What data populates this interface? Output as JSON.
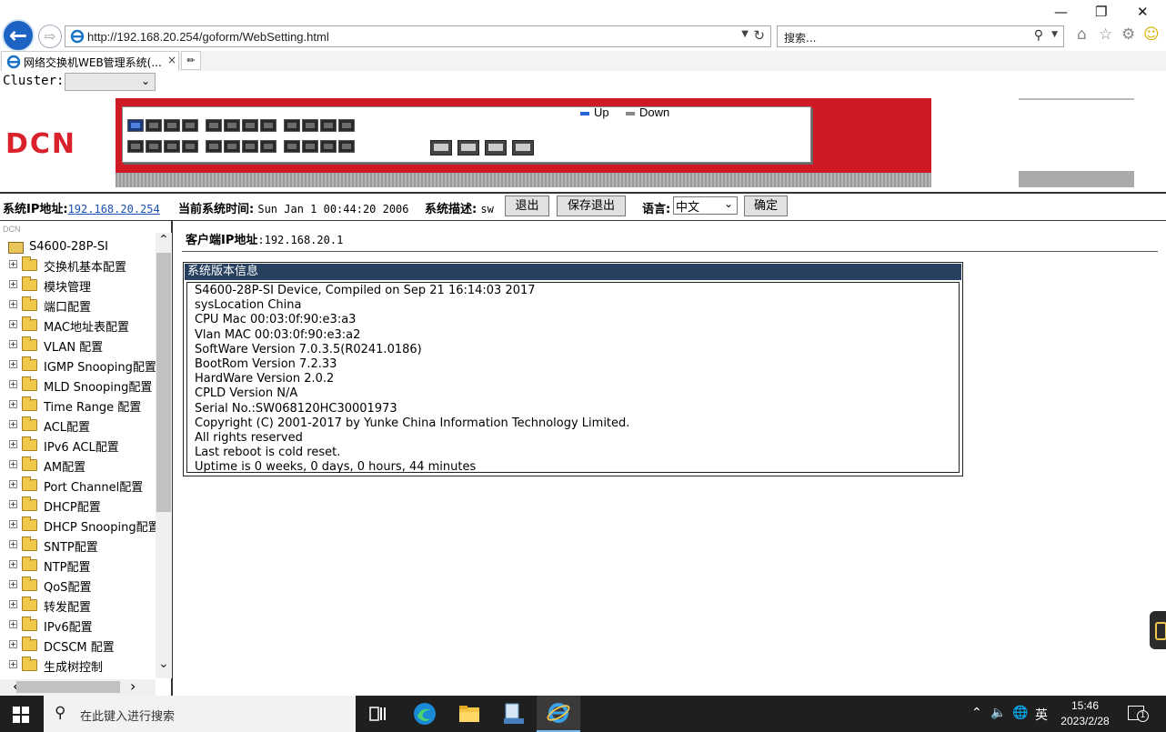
{
  "browser": {
    "url": "http://192.168.20.254/goform/WebSetting.html",
    "search_placeholder": "搜索...",
    "tab_title": "网络交换机WEB管理系统(...",
    "tab_close": "×"
  },
  "cluster": {
    "label": "Cluster:",
    "selected": ""
  },
  "header": {
    "logo_text": "DCN",
    "legend_up": "Up",
    "legend_down": "Down",
    "colors": {
      "banner": "#cf1a26",
      "port_up": "#4d7fdc",
      "port_down": "#6c6c6c"
    }
  },
  "status": {
    "ip_label": "系统IP地址:",
    "ip_value": "192.168.20.254",
    "time_label": "当前系统时间:",
    "time_value": "Sun Jan 1 00:44:20 2006",
    "desc_label": "系统描述:",
    "desc_value": "sw",
    "logout_label": "退出",
    "save_logout_label": "保存退出",
    "lang_label": "语言:",
    "lang_value": "中文",
    "confirm_label": "确定"
  },
  "tree": {
    "header": "DCN",
    "root": "S4600-28P-SI",
    "items": [
      "交换机基本配置",
      "模块管理",
      "端口配置",
      "MAC地址表配置",
      "VLAN 配置",
      "IGMP Snooping配置",
      "MLD Snooping配置",
      "Time Range 配置",
      "ACL配置",
      "IPv6 ACL配置",
      "AM配置",
      "Port Channel配置",
      "DHCP配置",
      "DHCP Snooping配置",
      "SNTP配置",
      "NTP配置",
      "QoS配置",
      "转发配置",
      "IPv6配置",
      "DCSCM 配置",
      "生成树控制"
    ]
  },
  "content": {
    "client_ip_label": "客户端IP地址",
    "client_ip_value": ":192.168.20.1",
    "version_title": "系统版本信息",
    "version_lines": [
      "S4600-28P-SI Device, Compiled on Sep 21 16:14:03 2017",
      "sysLocation China",
      "CPU Mac 00:03:0f:90:e3:a3",
      "Vlan MAC 00:03:0f:90:e3:a2",
      "SoftWare Version 7.0.3.5(R0241.0186)",
      "BootRom Version 7.2.33",
      "HardWare Version 2.0.2",
      "CPLD Version N/A",
      "Serial No.:SW068120HC30001973",
      "Copyright (C) 2001-2017 by Yunke China Information Technology Limited.",
      "All rights reserved",
      "Last reboot is cold reset.",
      "Uptime is 0 weeks, 0 days, 0 hours, 44 minutes"
    ]
  },
  "taskbar": {
    "search_placeholder": "在此键入进行搜索",
    "ime": "英",
    "time": "15:46",
    "date": "2023/2/28",
    "notification_count": "1"
  }
}
